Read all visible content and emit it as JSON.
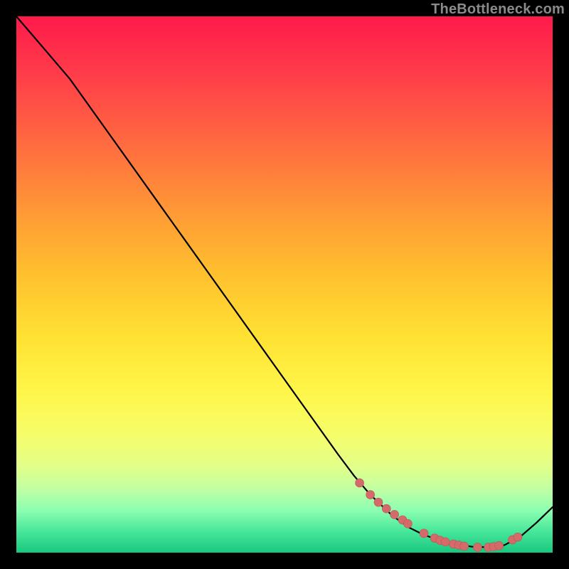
{
  "watermark": "TheBottleneck.com",
  "colors": {
    "gradient_top": "#ff1a4b",
    "gradient_bottom": "#18c77f",
    "curve_stroke": "#000000",
    "marker_fill": "#d46a6a",
    "marker_stroke": "#b85555",
    "frame": "#000000"
  },
  "chart_data": {
    "type": "line",
    "title": "",
    "xlabel": "",
    "ylabel": "",
    "xlim": [
      0,
      100
    ],
    "ylim": [
      0,
      100
    ],
    "grid": false,
    "legend": false,
    "series": [
      {
        "name": "curve",
        "x": [
          0,
          3,
          6,
          10,
          15,
          20,
          25,
          30,
          35,
          40,
          45,
          50,
          55,
          60,
          63,
          66,
          70,
          73,
          76,
          79,
          82,
          85,
          88,
          91,
          94,
          97,
          100
        ],
        "y": [
          100,
          96.5,
          93,
          88.3,
          81.3,
          74.3,
          67.3,
          60.3,
          53.3,
          46.3,
          39.3,
          32.3,
          25.3,
          18.3,
          14.3,
          10.8,
          7.0,
          4.8,
          3.3,
          2.3,
          1.6,
          1.1,
          1.0,
          1.4,
          3.0,
          5.6,
          8.5
        ]
      },
      {
        "name": "markers",
        "type": "scatter",
        "x": [
          64,
          66,
          67.5,
          69,
          70.5,
          72,
          73,
          76,
          78,
          79,
          80,
          81.5,
          82.5,
          83.5,
          86,
          88,
          89,
          90,
          92.5,
          93.5
        ],
        "y": [
          13.0,
          10.8,
          9.4,
          8.2,
          7.1,
          6.1,
          5.4,
          3.6,
          2.7,
          2.3,
          2.0,
          1.6,
          1.4,
          1.2,
          1.0,
          1.0,
          1.1,
          1.3,
          2.4,
          2.9
        ]
      }
    ]
  }
}
